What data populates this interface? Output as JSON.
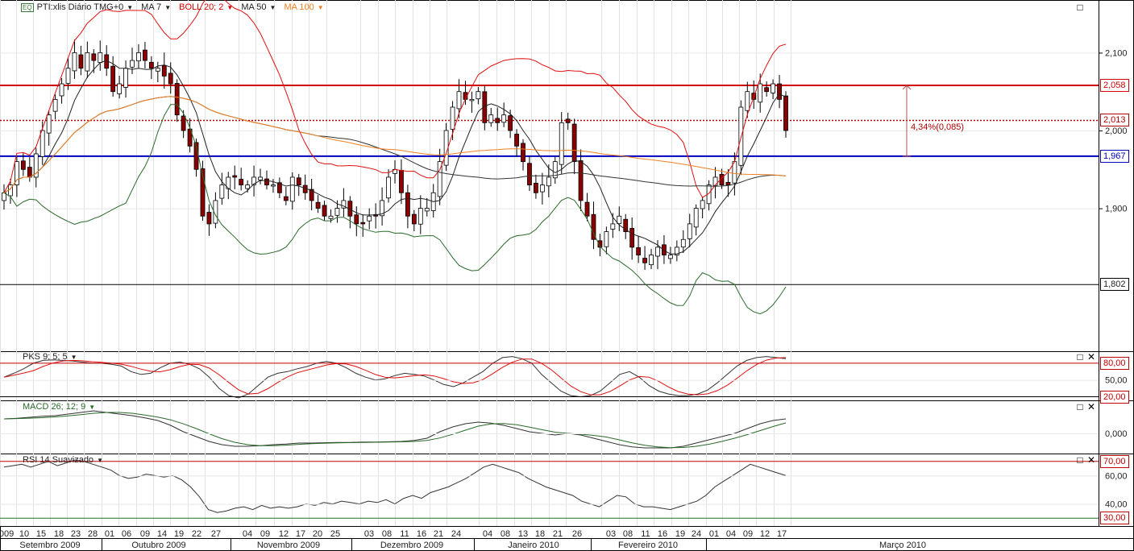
{
  "header": {
    "eq_tag": "EQ",
    "symbol": "PTI:xlis Diário TMG+0",
    "ma7": "MA 7",
    "boll": "BOLL 20; 2",
    "ma50": "MA 50",
    "ma100": "MA 100",
    "colors": {
      "ma7": "#000000",
      "boll": "#d40000",
      "ma50": "#000000",
      "ma100": "#f08020"
    }
  },
  "panels": {
    "pks_label": "PKS 9; 5; 5",
    "macd_label": "MACD 26; 12; 9",
    "rsi_label": "RSI 14 Suavizado"
  },
  "chart_data": [
    {
      "type": "candlestick",
      "name": "price",
      "y_tick_labels": [
        "2,100",
        "2,000",
        "1,900"
      ],
      "y_ticks": [
        2.1,
        2.0,
        1.9
      ],
      "ylim": [
        1.7,
        2.2
      ],
      "levels": [
        {
          "value": 2.058,
          "label": "2,058",
          "color": "#d40000",
          "style": "solid"
        },
        {
          "value": 2.013,
          "label": "2,013",
          "color": "#b00000",
          "style": "dotted"
        },
        {
          "value": 1.967,
          "label": "1,967",
          "color": "#0000c0",
          "style": "solid"
        },
        {
          "value": 1.802,
          "label": "1,802",
          "color": "#000000",
          "style": "solid"
        }
      ],
      "annotation": "4,34%(0,085)",
      "closes": [
        1.92,
        1.93,
        1.96,
        1.95,
        1.94,
        1.97,
        2.0,
        2.02,
        2.04,
        2.06,
        2.08,
        2.1,
        2.08,
        2.1,
        2.09,
        2.1,
        2.08,
        2.05,
        2.06,
        2.08,
        2.09,
        2.1,
        2.09,
        2.08,
        2.08,
        2.07,
        2.06,
        2.02,
        2.0,
        1.98,
        1.95,
        1.89,
        1.88,
        1.91,
        1.93,
        1.94,
        1.94,
        1.93,
        1.93,
        1.94,
        1.94,
        1.93,
        1.93,
        1.92,
        1.91,
        1.94,
        1.93,
        1.92,
        1.91,
        1.9,
        1.89,
        1.89,
        1.9,
        1.91,
        1.89,
        1.88,
        1.88,
        1.89,
        1.89,
        1.91,
        1.94,
        1.95,
        1.92,
        1.89,
        1.88,
        1.9,
        1.9,
        1.92,
        1.96,
        2.0,
        2.03,
        2.05,
        2.04,
        2.04,
        2.05,
        2.01,
        2.02,
        2.01,
        2.02,
        2.0,
        1.98,
        1.96,
        1.93,
        1.92,
        1.93,
        1.94,
        1.96,
        2.01,
        2.01,
        1.96,
        1.91,
        1.89,
        1.86,
        1.85,
        1.87,
        1.88,
        1.89,
        1.87,
        1.85,
        1.84,
        1.83,
        1.84,
        1.85,
        1.84,
        1.84,
        1.85,
        1.86,
        1.88,
        1.9,
        1.91,
        1.93,
        1.94,
        1.93,
        1.93,
        1.96,
        2.03,
        2.05,
        2.04,
        2.06,
        2.05,
        2.06,
        2.04,
        2.0
      ]
    },
    {
      "type": "line",
      "name": "pks",
      "y_tick_labels": [
        "80,00",
        "50,00",
        "20,00"
      ],
      "ylim": [
        15,
        100
      ],
      "values": [
        55,
        62,
        70,
        80,
        85,
        86,
        85,
        84,
        82,
        80,
        80,
        78,
        75,
        65,
        60,
        62,
        72,
        80,
        82,
        78,
        70,
        55,
        35,
        22,
        18,
        25,
        40,
        55,
        62,
        65,
        70,
        74,
        80,
        83,
        80,
        72,
        62,
        55,
        50,
        52,
        58,
        62,
        60,
        57,
        50,
        42,
        38,
        45,
        55,
        65,
        80,
        90,
        92,
        88,
        80,
        60,
        45,
        30,
        22,
        20,
        22,
        30,
        45,
        60,
        65,
        55,
        40,
        30,
        25,
        22,
        22,
        25,
        32,
        45,
        60,
        75,
        85,
        90,
        92,
        90,
        88
      ]
    },
    {
      "type": "line",
      "name": "macd",
      "y_tick_labels": [
        "0,000"
      ],
      "ylim": [
        -0.06,
        0.1
      ],
      "values": [
        0.045,
        0.047,
        0.05,
        0.053,
        0.055,
        0.06,
        0.065,
        0.07,
        0.065,
        0.06,
        0.055,
        0.048,
        0.04,
        0.025,
        0.005,
        -0.01,
        -0.025,
        -0.035,
        -0.04,
        -0.04,
        -0.038,
        -0.035,
        -0.033,
        -0.03,
        -0.03,
        -0.029,
        -0.028,
        -0.028,
        -0.027,
        -0.027,
        -0.026,
        -0.025,
        -0.022,
        -0.015,
        0.005,
        0.02,
        0.03,
        0.035,
        0.032,
        0.025,
        0.015,
        0.005,
        0.0,
        -0.005,
        0.0,
        -0.005,
        -0.015,
        -0.025,
        -0.035,
        -0.042,
        -0.045,
        -0.045,
        -0.045,
        -0.04,
        -0.03,
        -0.02,
        -0.01,
        0.0,
        0.015,
        0.03,
        0.04,
        0.045
      ]
    },
    {
      "type": "line",
      "name": "rsi",
      "y_tick_labels": [
        "70,00",
        "60,00",
        "40,00",
        "30,00"
      ],
      "ylim": [
        25,
        75
      ],
      "values": [
        66,
        67,
        68,
        66,
        68,
        70,
        67,
        69,
        71,
        70,
        68,
        66,
        64,
        60,
        58,
        59,
        61,
        60,
        59,
        60,
        57,
        52,
        45,
        36,
        34,
        35,
        37,
        38,
        36,
        39,
        37,
        38,
        37,
        38,
        40,
        39,
        41,
        40,
        42,
        41,
        40,
        42,
        41,
        43,
        40,
        44,
        46,
        44,
        48,
        50,
        52,
        55,
        58,
        62,
        66,
        68,
        66,
        64,
        62,
        58,
        55,
        52,
        50,
        48,
        46,
        42,
        40,
        38,
        42,
        46,
        45,
        40,
        38,
        38,
        37,
        36,
        38,
        40,
        42,
        46,
        52,
        56,
        60,
        64,
        68,
        66,
        64,
        62,
        60
      ]
    }
  ],
  "x_axis": {
    "day_labels": [
      "009",
      "10",
      "15",
      "18",
      "23",
      "28",
      "01",
      "06",
      "09",
      "14",
      "19",
      "22",
      "27",
      "04",
      "09",
      "12",
      "17",
      "20",
      "25",
      "03",
      "08",
      "11",
      "16",
      "21",
      "24",
      "04",
      "08",
      "13",
      "18",
      "21",
      "26",
      "03",
      "08",
      "11",
      "16",
      "19",
      "24",
      "01",
      "04",
      "09",
      "12",
      "17"
    ],
    "month_labels": [
      "Setembro 2009",
      "Outubro 2009",
      "Novembro 2009",
      "Dezembro 2009",
      "Janeiro 2010",
      "Fevereiro 2010",
      "Março 2010"
    ]
  }
}
